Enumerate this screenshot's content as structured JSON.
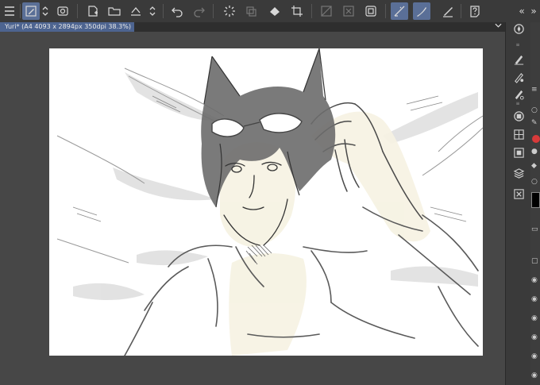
{
  "document": {
    "tab_label": "Yuri* (A4 4093 x 2894px 350dpi 38.3%)",
    "tab_menu_icon": "chevron-down-icon"
  },
  "toolbar": {
    "collapse_arrows": "«",
    "expand_arrows": "»"
  },
  "colors": {
    "app_bg": "#474747",
    "toolbar_bg": "#3a3a3a",
    "accent": "#5a6f97",
    "tab_active": "#4d6490",
    "current_color": "#000000"
  }
}
